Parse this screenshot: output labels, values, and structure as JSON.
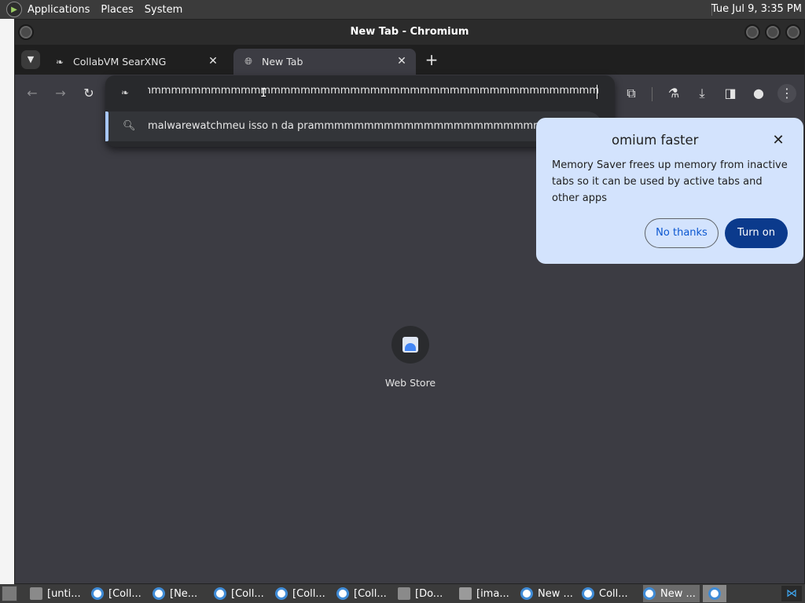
{
  "top_panel": {
    "menus": [
      "Applications",
      "Places",
      "System"
    ],
    "clock": "Tue Jul 9, 3:35 PM"
  },
  "window": {
    "title": "New Tab - Chromium"
  },
  "tabs": [
    {
      "title": "CollabVM SearXNG",
      "active": false
    },
    {
      "title": "New Tab",
      "active": true
    }
  ],
  "omnibox": {
    "input_value": "nmmmmmmmmmmmmmmmmmmmmmmmmmmmmmmmmmmmmmmmmmmmmmmmmmmmmmmmm",
    "suggestion": "malwarewatchmeu isso n da prammmmmmmmmmmmmmmmmmmmmmmmmmmmmmmmmm..."
  },
  "memory_saver": {
    "title": "omium faster",
    "body": "Memory Saver frees up memory from inactive tabs so it can be used by active tabs and other apps",
    "no_label": "No thanks",
    "yes_label": "Turn on"
  },
  "ntp": {
    "shortcut_label": "Web Store"
  },
  "taskbar": {
    "items": [
      {
        "label": "[unti...",
        "icon": "folder-icon"
      },
      {
        "label": "[Coll...",
        "icon": "chromium-icon"
      },
      {
        "label": "[Ne...",
        "icon": "chromium-icon"
      },
      {
        "label": "[Coll...",
        "icon": "chromium-icon"
      },
      {
        "label": "[Coll...",
        "icon": "chromium-icon"
      },
      {
        "label": "[Coll...",
        "icon": "chromium-icon"
      },
      {
        "label": "[Do...",
        "icon": "folder-icon"
      },
      {
        "label": "[ima...",
        "icon": "image-viewer-icon"
      },
      {
        "label": "New ...",
        "icon": "chromium-icon"
      },
      {
        "label": "Coll...",
        "icon": "chromium-icon"
      },
      {
        "label": "New ...",
        "icon": "chromium-icon"
      }
    ]
  },
  "colors": {
    "accent": "#0b3a8c",
    "bubble_bg": "#d3e3fd",
    "omnibox_bg": "#28292c",
    "page_bg": "#3c3c43"
  }
}
